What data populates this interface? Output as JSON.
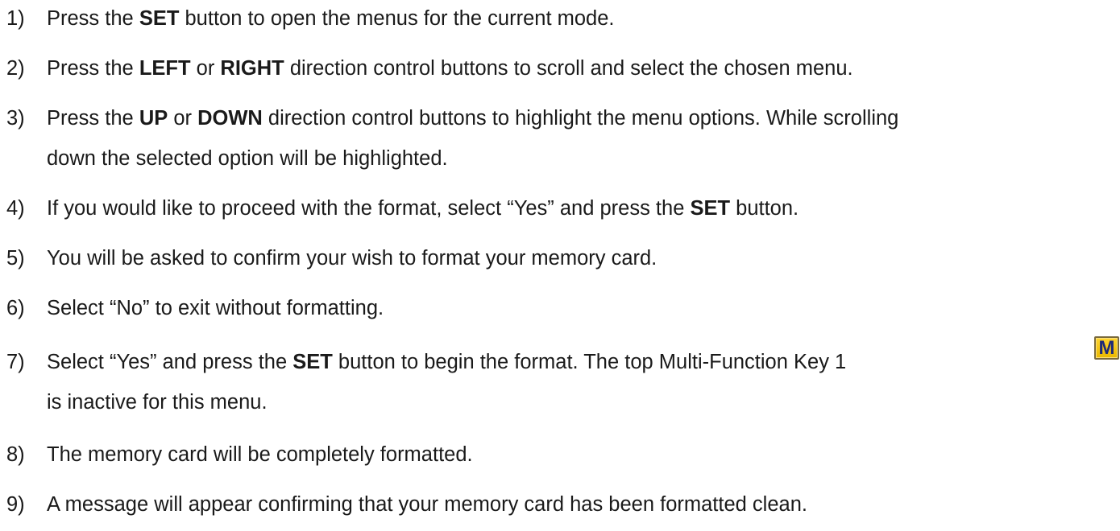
{
  "steps": [
    {
      "number": "1)",
      "lines": [
        {
          "a": "Press the ",
          "b": "SET",
          "c": " button to open the menus for the current mode."
        }
      ]
    },
    {
      "number": "2)",
      "lines": [
        {
          "a": "Press the ",
          "b": "LEFT",
          "c": " or ",
          "d": "RIGHT",
          "e": " direction control buttons to scroll and select the chosen menu."
        }
      ]
    },
    {
      "number": "3)",
      "lines": [
        {
          "a": "Press the ",
          "b": "UP",
          "c": " or ",
          "d": "DOWN",
          "e": " direction control buttons to highlight the menu options. While scrolling"
        },
        {
          "a": "down the selected option will be highlighted."
        }
      ]
    },
    {
      "number": "4)",
      "lines": [
        {
          "a": "If you would like to proceed with the format, select “Yes” and press the ",
          "b": "SET",
          "c": " button."
        }
      ]
    },
    {
      "number": "5)",
      "lines": [
        {
          "a": "You will be asked to confirm your wish to format your memory card."
        }
      ]
    },
    {
      "number": "6)",
      "lines": [
        {
          "a": "Select “No” to exit without formatting."
        }
      ]
    },
    {
      "number": "7)",
      "lines": [
        {
          "a": "Select “Yes” and press the ",
          "b": "SET",
          "c": " button to begin the format. The top Multi-Function Key 1"
        },
        {
          "a": "is inactive for this menu."
        }
      ]
    },
    {
      "number": "8)",
      "lines": [
        {
          "a": "The memory card will be completely formatted."
        }
      ]
    },
    {
      "number": "9)",
      "lines": [
        {
          "a": "A message will appear confirming that your memory card has been formatted clean."
        }
      ]
    }
  ],
  "icons": {
    "multi_function_key_1": {
      "name": "m-key-icon",
      "letter": "M",
      "fill": "#f5c400",
      "letter_color": "#1e2a78"
    }
  }
}
